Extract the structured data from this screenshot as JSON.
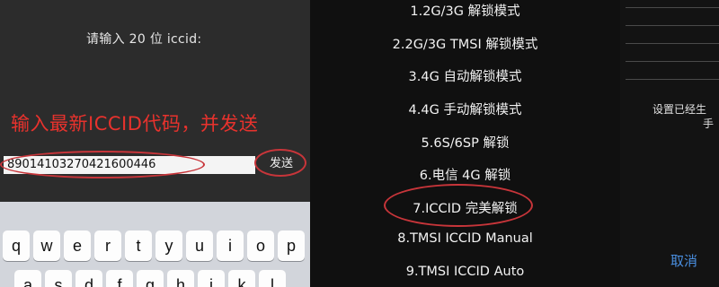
{
  "left": {
    "prompt": "请输入 20 位 iccid:",
    "note": "输入最新ICCID代码，并发送",
    "iccid_value": "89014103270421600446",
    "send_label": "发送"
  },
  "keyboard": {
    "row1": [
      "q",
      "w",
      "e",
      "r",
      "t",
      "y",
      "u",
      "i",
      "o",
      "p"
    ],
    "row2": [
      "a",
      "s",
      "d",
      "f",
      "g",
      "h",
      "j",
      "k",
      "l"
    ]
  },
  "menu": {
    "items": [
      "1.2G/3G 解锁模式",
      "2.2G/3G TMSI 解锁模式",
      "3.4G 自动解锁模式",
      "4.4G 手动解锁模式",
      "5.6S/6SP 解锁",
      "6.电信 4G 解锁",
      "7.ICCID 完美解锁",
      "8.TMSI ICCID Manual",
      "9.TMSI ICCID Auto"
    ],
    "highlighted_index": 6
  },
  "right": {
    "message_line1": "设置已经生",
    "message_line2": "手",
    "cancel_label": "取消"
  },
  "colors": {
    "annotation_red": "#c8353a",
    "note_red": "#e8322d",
    "cancel_blue": "#4a8fe0"
  }
}
